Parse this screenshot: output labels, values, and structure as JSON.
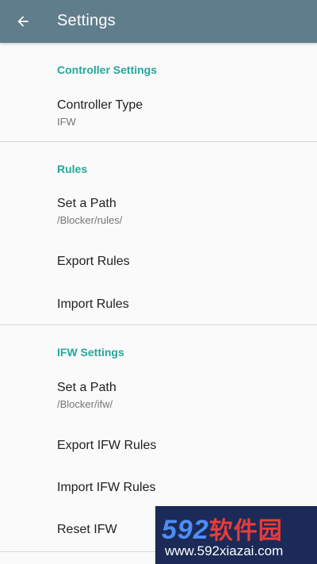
{
  "appbar": {
    "title": "Settings",
    "color": "#607d8b"
  },
  "sections": {
    "controller": {
      "header": "Controller Settings",
      "type_title": "Controller Type",
      "type_value": "IFW"
    },
    "rules": {
      "header": "Rules",
      "path_title": "Set a Path",
      "path_value": "/Blocker/rules/",
      "export_label": "Export Rules",
      "import_label": "Import Rules"
    },
    "ifw": {
      "header": "IFW Settings",
      "path_title": "Set a Path",
      "path_value": "/Blocker/ifw/",
      "export_label": "Export IFW Rules",
      "import_label": "Import IFW Rules",
      "reset_label": "Reset IFW"
    }
  },
  "accent_color": "#26a69a",
  "watermark": {
    "brand_number": "592",
    "brand_cjk": "软件园",
    "url": "www.592xiazai.com"
  }
}
